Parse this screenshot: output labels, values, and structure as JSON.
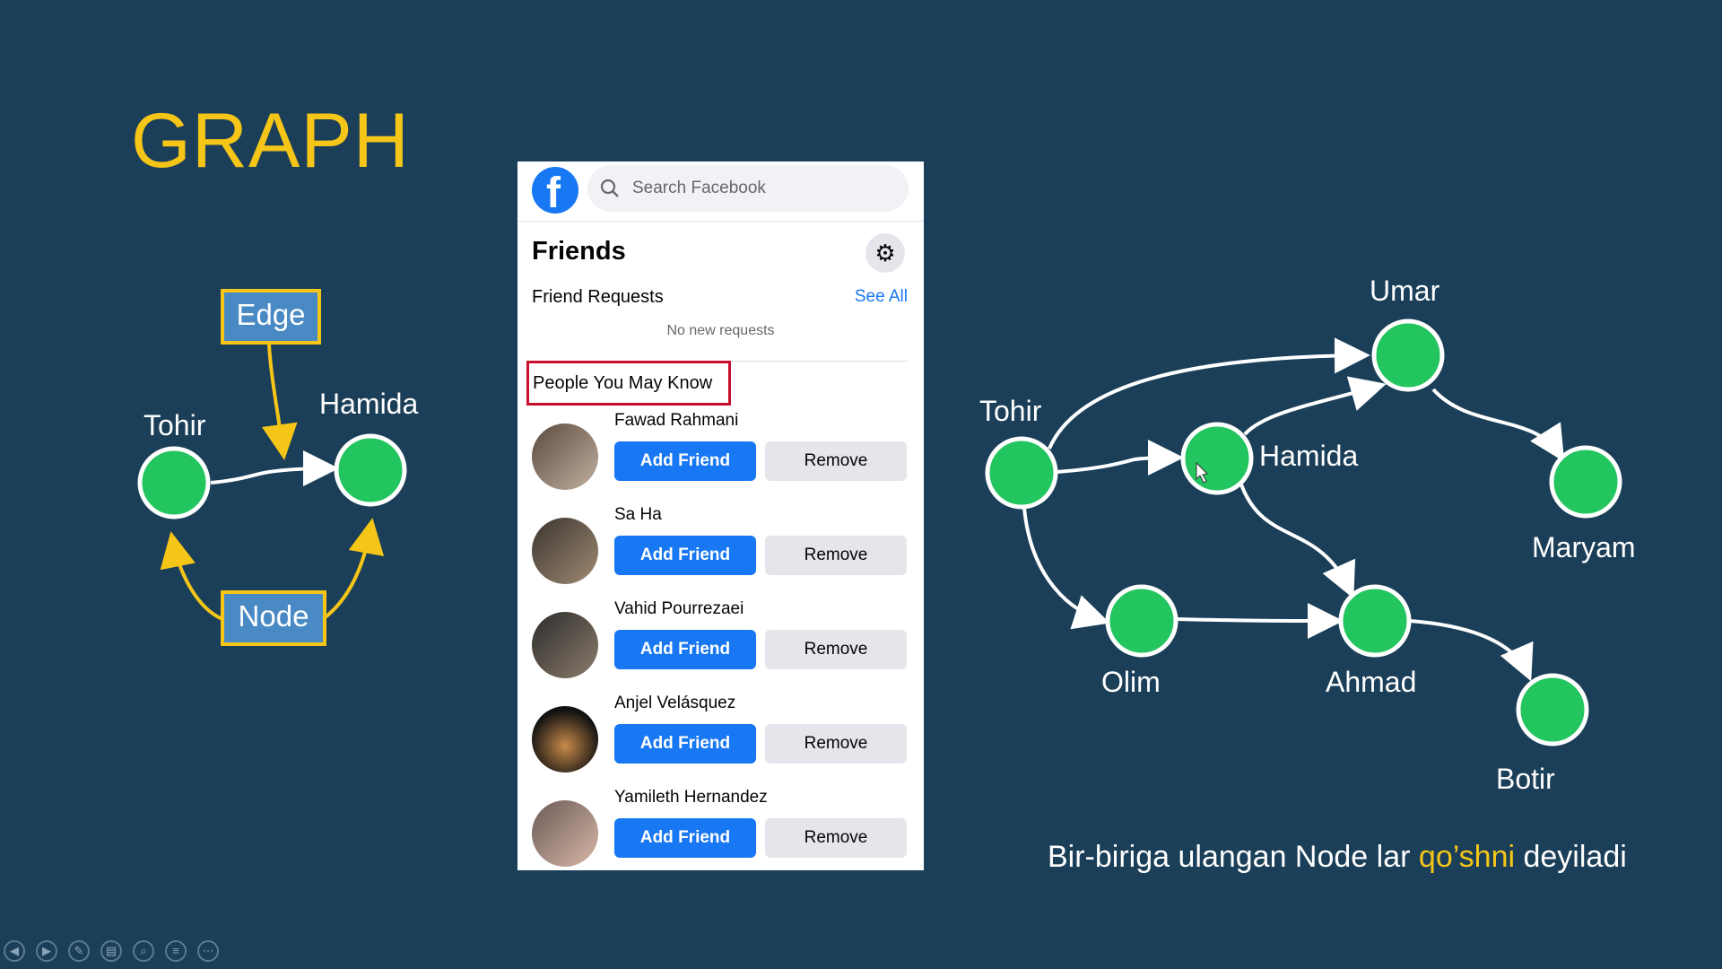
{
  "slide": {
    "title": "GRAPH",
    "caption_part1": "Bir-biriga ulangan Node lar ",
    "caption_highlight": "qo’shni",
    "caption_part2": " deyiladi",
    "colors": {
      "background": "#1b3f58",
      "title": "#f5c518",
      "node": "#22c55e",
      "tag_bg": "#4a8ac4"
    }
  },
  "left_diagram": {
    "edge_tag": "Edge",
    "node_tag": "Node",
    "nodes": [
      "Tohir",
      "Hamida"
    ]
  },
  "right_diagram": {
    "nodes": [
      "Umar",
      "Tohir",
      "Hamida",
      "Maryam",
      "Olim",
      "Ahmad",
      "Botir"
    ],
    "edges": [
      [
        "Tohir",
        "Umar"
      ],
      [
        "Tohir",
        "Hamida"
      ],
      [
        "Tohir",
        "Olim"
      ],
      [
        "Hamida",
        "Umar"
      ],
      [
        "Hamida",
        "Ahmad"
      ],
      [
        "Umar",
        "Maryam"
      ],
      [
        "Olim",
        "Ahmad"
      ],
      [
        "Ahmad",
        "Botir"
      ]
    ]
  },
  "facebook": {
    "logo": "f",
    "search_placeholder": "Search Facebook",
    "heading": "Friends",
    "gear_icon": "gear-icon",
    "friend_requests": "Friend Requests",
    "see_all": "See All",
    "no_requests": "No new requests",
    "pymk": "People You May Know",
    "people": [
      {
        "name": "Fawad Rahmani",
        "add": "Add Friend",
        "remove": "Remove"
      },
      {
        "name": "Sa Ha",
        "add": "Add Friend",
        "remove": "Remove"
      },
      {
        "name": "Vahid Pourrezaei",
        "add": "Add Friend",
        "remove": "Remove"
      },
      {
        "name": "Anjel Velásquez",
        "add": "Add Friend",
        "remove": "Remove"
      },
      {
        "name": "Yamileth Hernandez",
        "add": "Add Friend",
        "remove": "Remove"
      }
    ]
  },
  "toolbar": {
    "icons": [
      "prev-icon",
      "next-icon",
      "pen-icon",
      "slides-icon",
      "zoom-icon",
      "subtitle-icon",
      "more-icon"
    ]
  }
}
